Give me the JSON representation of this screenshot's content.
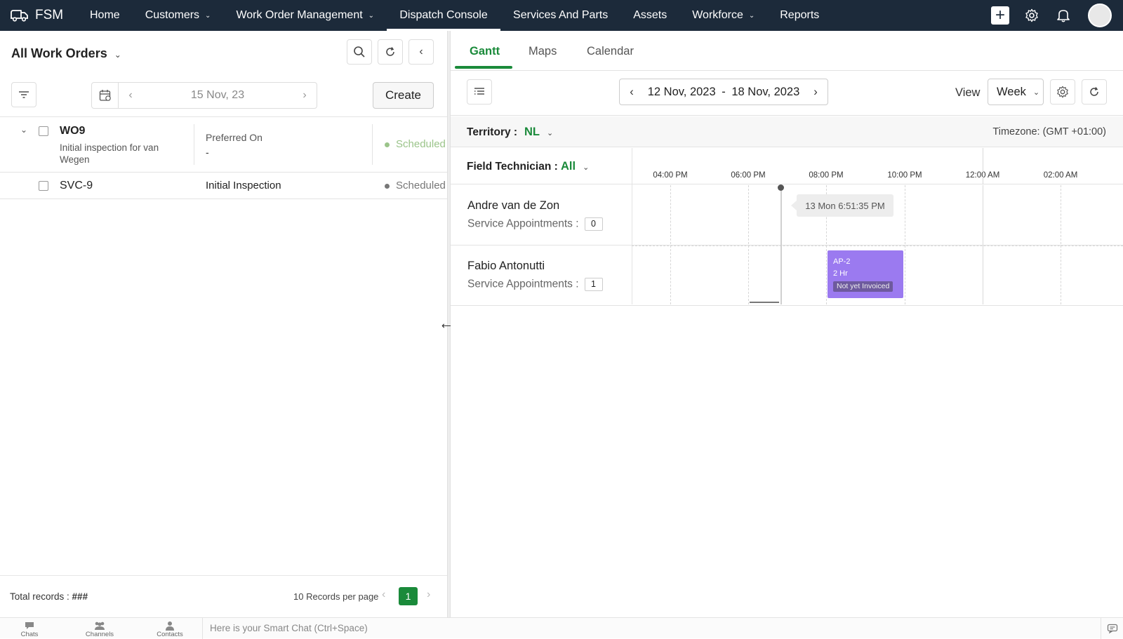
{
  "app": {
    "brand": "FSM",
    "nav": [
      {
        "label": "Home",
        "has_menu": false
      },
      {
        "label": "Customers",
        "has_menu": true
      },
      {
        "label": "Work Order Management",
        "has_menu": true
      },
      {
        "label": "Dispatch Console",
        "has_menu": false,
        "active": true
      },
      {
        "label": "Services And Parts",
        "has_menu": false
      },
      {
        "label": "Assets",
        "has_menu": false
      },
      {
        "label": "Workforce",
        "has_menu": true
      },
      {
        "label": "Reports",
        "has_menu": false
      }
    ],
    "icons": [
      "plus-icon",
      "gear-icon",
      "bell-icon",
      "avatar"
    ]
  },
  "left_panel": {
    "title": "All Work Orders",
    "date": "15 Nov, 23",
    "create_label": "Create",
    "work_orders": [
      {
        "id": "WO9",
        "description": "Initial inspection for van Wegen",
        "preferred_label": "Preferred On",
        "preferred_value": "-",
        "status": "Scheduled",
        "services": [
          {
            "id": "SVC-9",
            "name": "Initial Inspection",
            "status": "Scheduled"
          }
        ]
      }
    ],
    "footer": {
      "total_label": "Total records : ",
      "total_value": "###",
      "per_page": "10 Records per page",
      "page": "1"
    }
  },
  "right_panel": {
    "tabs": [
      "Gantt",
      "Maps",
      "Calendar"
    ],
    "active_tab": "Gantt",
    "range_start": "12 Nov, 2023",
    "range_sep": "-",
    "range_end": "18 Nov, 2023",
    "view_label": "View",
    "view_value": "Week",
    "territory_label": "Territory :",
    "territory_value": "NL",
    "timezone": "Timezone: (GMT +01:00)",
    "tech_filter_label": "Field Technician :",
    "tech_filter_value": "All",
    "time_ticks": [
      "04:00 PM",
      "06:00 PM",
      "08:00 PM",
      "10:00 PM",
      "12:00 AM",
      "02:00 AM"
    ],
    "now_tooltip": "13 Mon 6:51:35 PM",
    "technicians": [
      {
        "name": "Andre van de Zon",
        "sa_label": "Service Appointments :",
        "sa_count": "0"
      },
      {
        "name": "Fabio Antonutti",
        "sa_label": "Service Appointments :",
        "sa_count": "1"
      }
    ],
    "appointment": {
      "id": "AP-2",
      "duration": "2 Hr",
      "status": "Not yet Invoiced",
      "color": "#9b7af0"
    }
  },
  "bottom_bar": {
    "items": [
      "Chats",
      "Channels",
      "Contacts"
    ],
    "smart_chat_placeholder": "Here is your Smart Chat (Ctrl+Space)"
  },
  "colors": {
    "nav_bg": "#1c2a3a",
    "accent": "#1a8a3a",
    "scheduled_main": "#9bc48a",
    "scheduled_sub": "#777777"
  }
}
